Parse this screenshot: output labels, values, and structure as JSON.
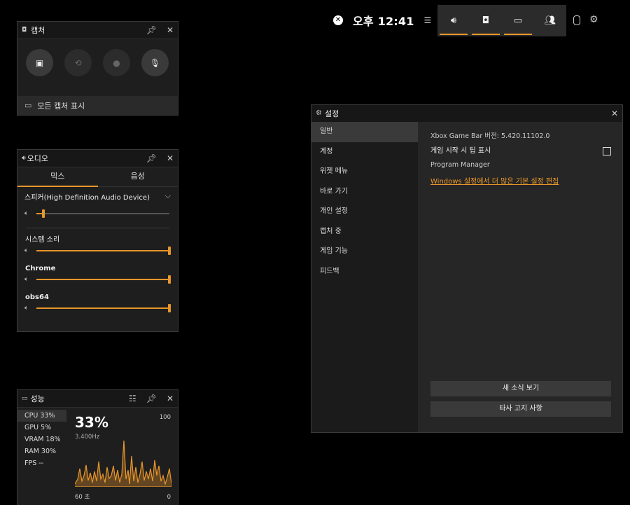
{
  "topbar": {
    "clock": "오후 12:41",
    "xbox_icon": "xbox-logo-icon",
    "widgets": [
      "audio-icon",
      "capture-icon",
      "performance-icon",
      "social-icon"
    ]
  },
  "capture": {
    "title": "캡처",
    "footer": "모든 캡처 표시"
  },
  "audio": {
    "title": "오디오",
    "tabs": [
      "믹스",
      "음성"
    ],
    "device": "스피커(High Definition Audio Device)",
    "device_level": 0.05,
    "apps": [
      {
        "name": "시스템 소리",
        "level": 1.0
      },
      {
        "name": "Chrome",
        "level": 1.0
      },
      {
        "name": "obs64",
        "level": 1.0
      }
    ]
  },
  "perf": {
    "title": "성능",
    "items": [
      "CPU  33%",
      "GPU   5%",
      "VRAM  18%",
      "RAM  30%",
      "FPS   --"
    ],
    "big": "33%",
    "sub": "3.400Hz",
    "max": "100",
    "min": "0",
    "xlabel": "60 초",
    "accent": "#e8962a"
  },
  "settings": {
    "title": "설정",
    "nav": [
      "일반",
      "계정",
      "위젯 메뉴",
      "바로 가기",
      "개인 설정",
      "캡처 중",
      "게임 기능",
      "피드백"
    ],
    "version": "Xbox Game Bar 버전: 5.420.11102.0",
    "tip": "게임 시작 시 팁 표시",
    "program": "Program Manager",
    "link": "Windows 설정에서 더 많은 기본 설정 편집",
    "btn_news": "새 소식 보기",
    "btn_notice": "타사 고지 사항"
  }
}
